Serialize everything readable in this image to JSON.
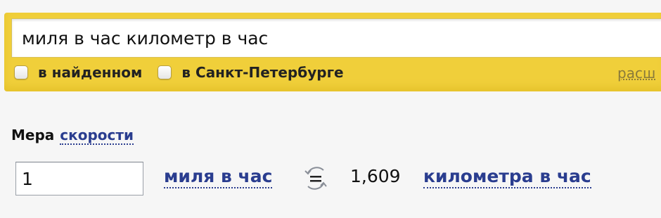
{
  "search": {
    "query": "миля в час километр в час"
  },
  "filters": [
    {
      "label": "в найденном",
      "checked": false
    },
    {
      "label": "в Санкт-Петербурге",
      "checked": false
    }
  ],
  "expand_link": "расш",
  "converter": {
    "measure_label": "Мера",
    "measure_type": "скорости",
    "input_value": "1",
    "from_unit": "миля в час",
    "result": "1,609",
    "to_unit": "километра в час"
  },
  "colors": {
    "header_yellow": "#f0cf3a",
    "link_blue": "#2a3d8f"
  },
  "icons": {
    "swap": "swap-equals-icon",
    "checkbox": "checkbox-icon"
  }
}
